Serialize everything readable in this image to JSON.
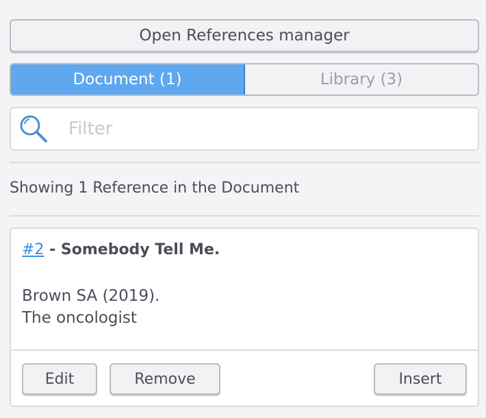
{
  "manager_button": "Open References manager",
  "tabs": [
    {
      "label": "Document (1)",
      "active": true
    },
    {
      "label": "Library (3)",
      "active": false
    }
  ],
  "filter": {
    "placeholder": "Filter",
    "value": "",
    "icon": "search-icon"
  },
  "showing_text": "Showing 1 Reference in the Document",
  "reference": {
    "number_link": "#2",
    "title_suffix": " - Somebody Tell Me.",
    "authors_year": "Brown SA (2019).",
    "journal": "The oncologist"
  },
  "actions": {
    "edit": "Edit",
    "remove": "Remove",
    "insert": "Insert"
  },
  "colors": {
    "accent": "#5fa7ef",
    "link": "#3a8de0"
  }
}
